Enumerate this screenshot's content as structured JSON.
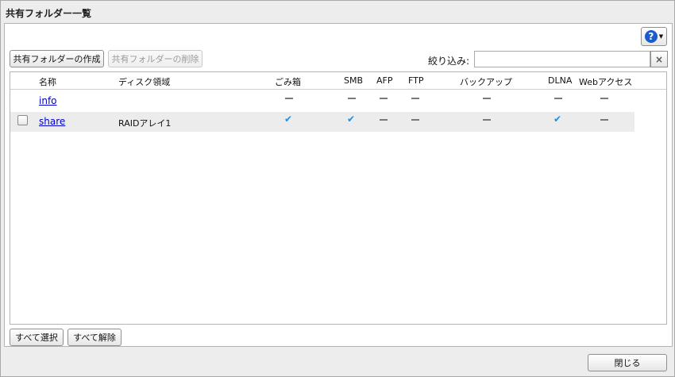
{
  "window": {
    "title": "共有フォルダー一覧"
  },
  "toolbar": {
    "create_label": "共有フォルダーの作成",
    "delete_label": "共有フォルダーの削除",
    "help_icon": "question-circle-icon",
    "filter_label": "絞り込み:",
    "filter_value": "",
    "clear_icon": "×"
  },
  "table": {
    "headers": [
      "名称",
      "ディスク領域",
      "ごみ箱",
      "SMB",
      "AFP",
      "FTP",
      "バックアップ",
      "DLNA",
      "Webアクセス"
    ],
    "rows": [
      {
        "name": "info",
        "disk": "",
        "trash": "—",
        "smb": "—",
        "afp": "—",
        "ftp": "—",
        "backup": "—",
        "dlna": "—",
        "web": "—",
        "has_checkbox": false
      },
      {
        "name": "share",
        "disk": "RAIDアレイ1",
        "trash": "✔",
        "smb": "✔",
        "afp": "—",
        "ftp": "—",
        "backup": "—",
        "dlna": "✔",
        "web": "—",
        "has_checkbox": true
      }
    ]
  },
  "footer": {
    "select_all_label": "すべて選択",
    "deselect_all_label": "すべて解除",
    "close_label": "閉じる"
  },
  "colors": {
    "link": "#0000cc",
    "check": "#1e8fdc",
    "help": "#1a5ccc"
  }
}
